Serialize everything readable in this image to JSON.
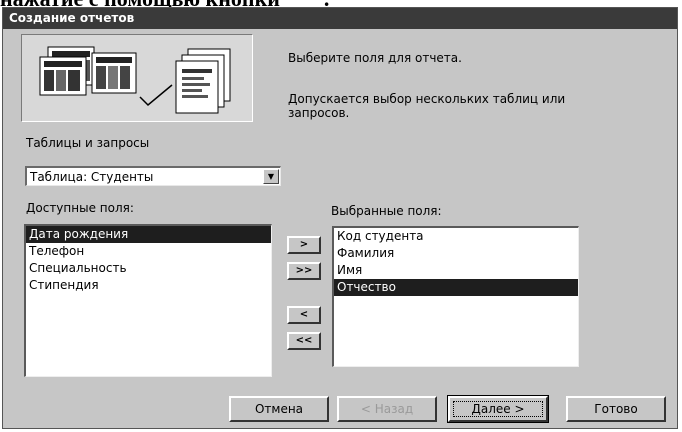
{
  "page_fragment": {
    "text": "нажатие с помощью кнопки",
    "suffix": "."
  },
  "window": {
    "title": "Создание отчетов"
  },
  "instructions": {
    "line1": "Выберите поля для отчета.",
    "line2": "Допускается выбор нескольких таблиц или запросов."
  },
  "tables_queries": {
    "label": "Таблицы и запросы",
    "selected": "Таблица: Студенты"
  },
  "available_fields": {
    "label": "Доступные поля:",
    "items": [
      "Дата рождения",
      "Телефон",
      "Специальность",
      "Стипендия"
    ],
    "selected_index": 0
  },
  "selected_fields": {
    "label": "Выбранные поля:",
    "items": [
      "Код студента",
      "Фамилия",
      "Имя",
      "Отчество"
    ],
    "selected_index": 3
  },
  "move_buttons": {
    "add_one": ">",
    "add_all": ">>",
    "remove_one": "<",
    "remove_all": "<<"
  },
  "footer_buttons": {
    "cancel": "Отмена",
    "back": "< Назад",
    "next": "Далее >",
    "finish": "Готово"
  }
}
